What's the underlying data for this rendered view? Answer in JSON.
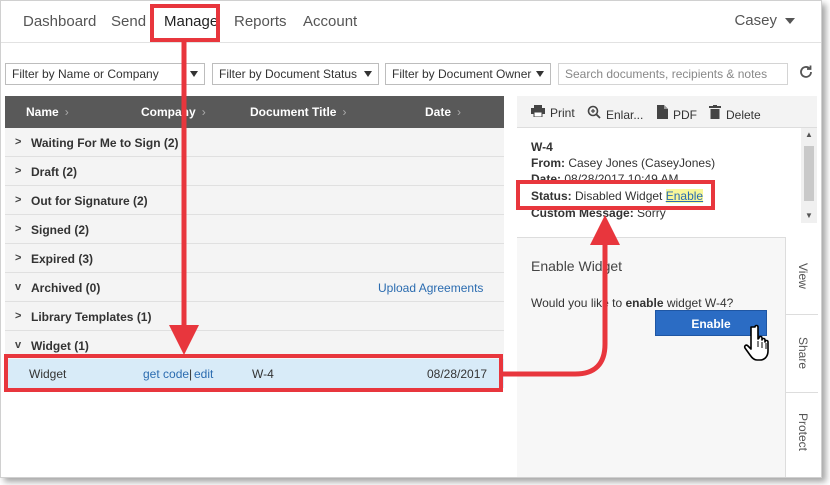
{
  "nav": {
    "items": [
      "Dashboard",
      "Send",
      "Manage",
      "Reports",
      "Account"
    ],
    "user": "Casey"
  },
  "filters": {
    "name_company": "Filter by Name or Company",
    "status": "Filter by Document Status",
    "owner": "Filter by Document Owner",
    "search_placeholder": "Search documents, recipients & notes"
  },
  "table": {
    "headers": [
      "Name",
      "Company",
      "Document Title",
      "Date"
    ],
    "groups": [
      {
        "label": "Waiting For Me to Sign (2)",
        "toggle": ">"
      },
      {
        "label": "Draft (2)",
        "toggle": ">"
      },
      {
        "label": "Out for Signature (2)",
        "toggle": ">"
      },
      {
        "label": "Signed (2)",
        "toggle": ">"
      },
      {
        "label": "Expired (3)",
        "toggle": ">"
      },
      {
        "label": "Archived (0)",
        "toggle": "v"
      },
      {
        "label": "Library Templates (1)",
        "toggle": ">"
      },
      {
        "label": "Widget (1)",
        "toggle": "v"
      }
    ],
    "upload_link": "Upload Agreements",
    "row": {
      "name": "Widget",
      "get_code": "get code",
      "sep": "|",
      "edit": "edit",
      "title": "W-4",
      "date": "08/28/2017"
    }
  },
  "toolbar": {
    "print": "Print",
    "enlarge": "Enlar...",
    "pdf": "PDF",
    "delete": "Delete"
  },
  "details": {
    "title": "W-4",
    "from_label": "From:",
    "from_value": "Casey Jones (CaseyJones)",
    "date_label": "Date:",
    "date_value": "08/28/2017 10:49 AM",
    "status_label": "Status:",
    "status_value": "Disabled Widget",
    "enable_link": "Enable",
    "custom_label": "Custom Message:",
    "custom_value": "Sorry"
  },
  "enable_panel": {
    "title": "Enable Widget",
    "question_pre": "Would you like to ",
    "question_bold": "enable",
    "question_post": " widget W-4?",
    "button": "Enable"
  },
  "side_tabs": [
    "View",
    "Share",
    "Protect"
  ],
  "colors": {
    "annotation_red": "#e8363d",
    "header_gray": "#595959",
    "selected_row": "#d8ebf8",
    "primary_blue": "#2b6cc4",
    "link_blue": "#2b6cb0"
  }
}
